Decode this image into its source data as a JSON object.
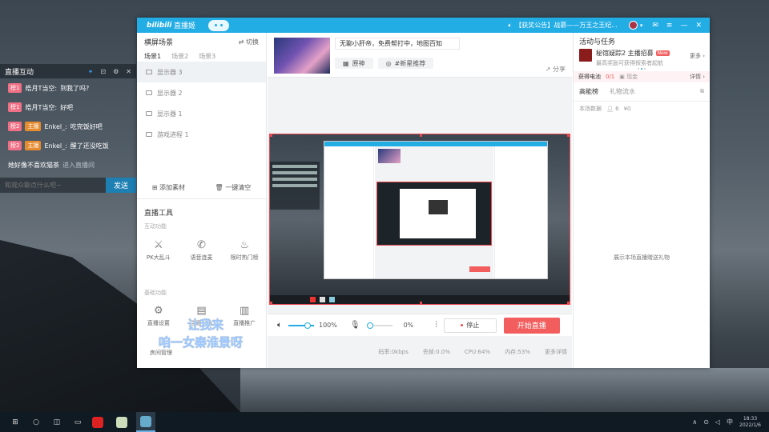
{
  "overlay": {
    "title": "直播互动",
    "messages": [
      {
        "badge": "榜1",
        "name": "皓月T当空:",
        "text": "到我了吗?",
        "host": ""
      },
      {
        "badge": "榜1",
        "name": "皓月T当空:",
        "text": "好吧",
        "host": ""
      },
      {
        "badge": "榜2",
        "host": "主播",
        "name": "Enkel_:",
        "text": "吃完饭好吧"
      },
      {
        "badge": "榜2",
        "host": "主播",
        "name": "Enkel_:",
        "text": "醒了还没吃饭"
      }
    ],
    "join_name": "她好像不喜欢猫茶",
    "join_text": "进入直播间",
    "input_placeholder": "和观众聊点什么吧~",
    "send_label": "发送"
  },
  "window": {
    "logo": "bilibili",
    "app_title": "直播姬",
    "notice": "【获奖公告】战慕——万王之王纪...",
    "left": {
      "scene_title": "横屏场景",
      "switch_label": "切换",
      "tabs": [
        "场景1",
        "场景2",
        "场景3"
      ],
      "sources": [
        "显示器 3",
        "显示器 2",
        "显示器 1",
        "游戏进程 1"
      ],
      "add_label": "添加素材",
      "clear_label": "一键清空",
      "tools_title": "直播工具",
      "interact_title": "互动功能",
      "interact_tools": [
        "PK大乱斗",
        "语音连麦",
        "限时热门榜"
      ],
      "basic_title": "基础功能",
      "basic_tools": [
        "直播设置",
        "房间管理",
        "主题公告",
        "直播推广"
      ]
    },
    "center": {
      "stream_title": "无聊小肝帝，免费帮打中，地图百知",
      "category": "原神",
      "tag": "#新星推荐",
      "share": "分享",
      "volume": "100%",
      "mic": "0%",
      "stop_label": "停止",
      "start_label": "开始直播",
      "status": [
        "码率:0kbps",
        "丢帧:0.0%",
        "CPU:64%",
        "内存:53%",
        "更多详情"
      ],
      "caption_line1": "让我来",
      "caption_line2": "咱一女秦淮景呀"
    },
    "right": {
      "title": "活动与任务",
      "task_name": "秘馆疑踪2 主播招募",
      "task_badge": "New",
      "task_desc": "最高奖励可获得探索者起航",
      "more": "更多",
      "progress_label": "获得电池",
      "progress": "0/1",
      "reward": "现金",
      "details": "详情",
      "tabs": [
        "高能榜",
        "礼物流水"
      ],
      "data_label": "本场数据",
      "people": "6",
      "money": "¥0",
      "empty": "展示本场直播赠送礼物"
    }
  },
  "taskbar": {
    "time": "18:33",
    "date": "2022/1/6"
  },
  "colors": {
    "brand": "#23ade5",
    "start": "#f25d5d",
    "badge_fans": "#f07186",
    "badge_host": "#e68b2e"
  }
}
